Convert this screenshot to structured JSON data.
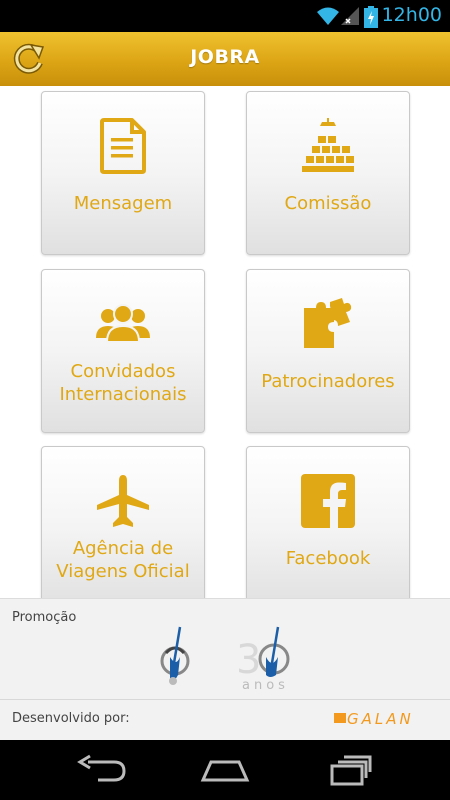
{
  "status_bar": {
    "time": "12h00"
  },
  "app_bar": {
    "title": "JOBRA"
  },
  "menu": {
    "items": [
      {
        "label": "Mensagem",
        "icon": "document-icon"
      },
      {
        "label": "Comissão",
        "icon": "committee-icon"
      },
      {
        "label_line1": "Convidados",
        "label_line2": "Internacionais",
        "icon": "people-icon"
      },
      {
        "label": "Patrocinadores",
        "icon": "puzzle-icon"
      },
      {
        "label_line1": "Agência de",
        "label_line2": "Viagens Oficial",
        "icon": "airplane-icon"
      },
      {
        "label": "Facebook",
        "icon": "facebook-icon"
      }
    ]
  },
  "footer": {
    "promo_label": "Promoção",
    "anos_text": "anos",
    "dev_label": "Desenvolvido por:",
    "dev_brand": "GALAN"
  },
  "colors": {
    "accent": "#e0a815",
    "app_bar": "#dca515"
  }
}
